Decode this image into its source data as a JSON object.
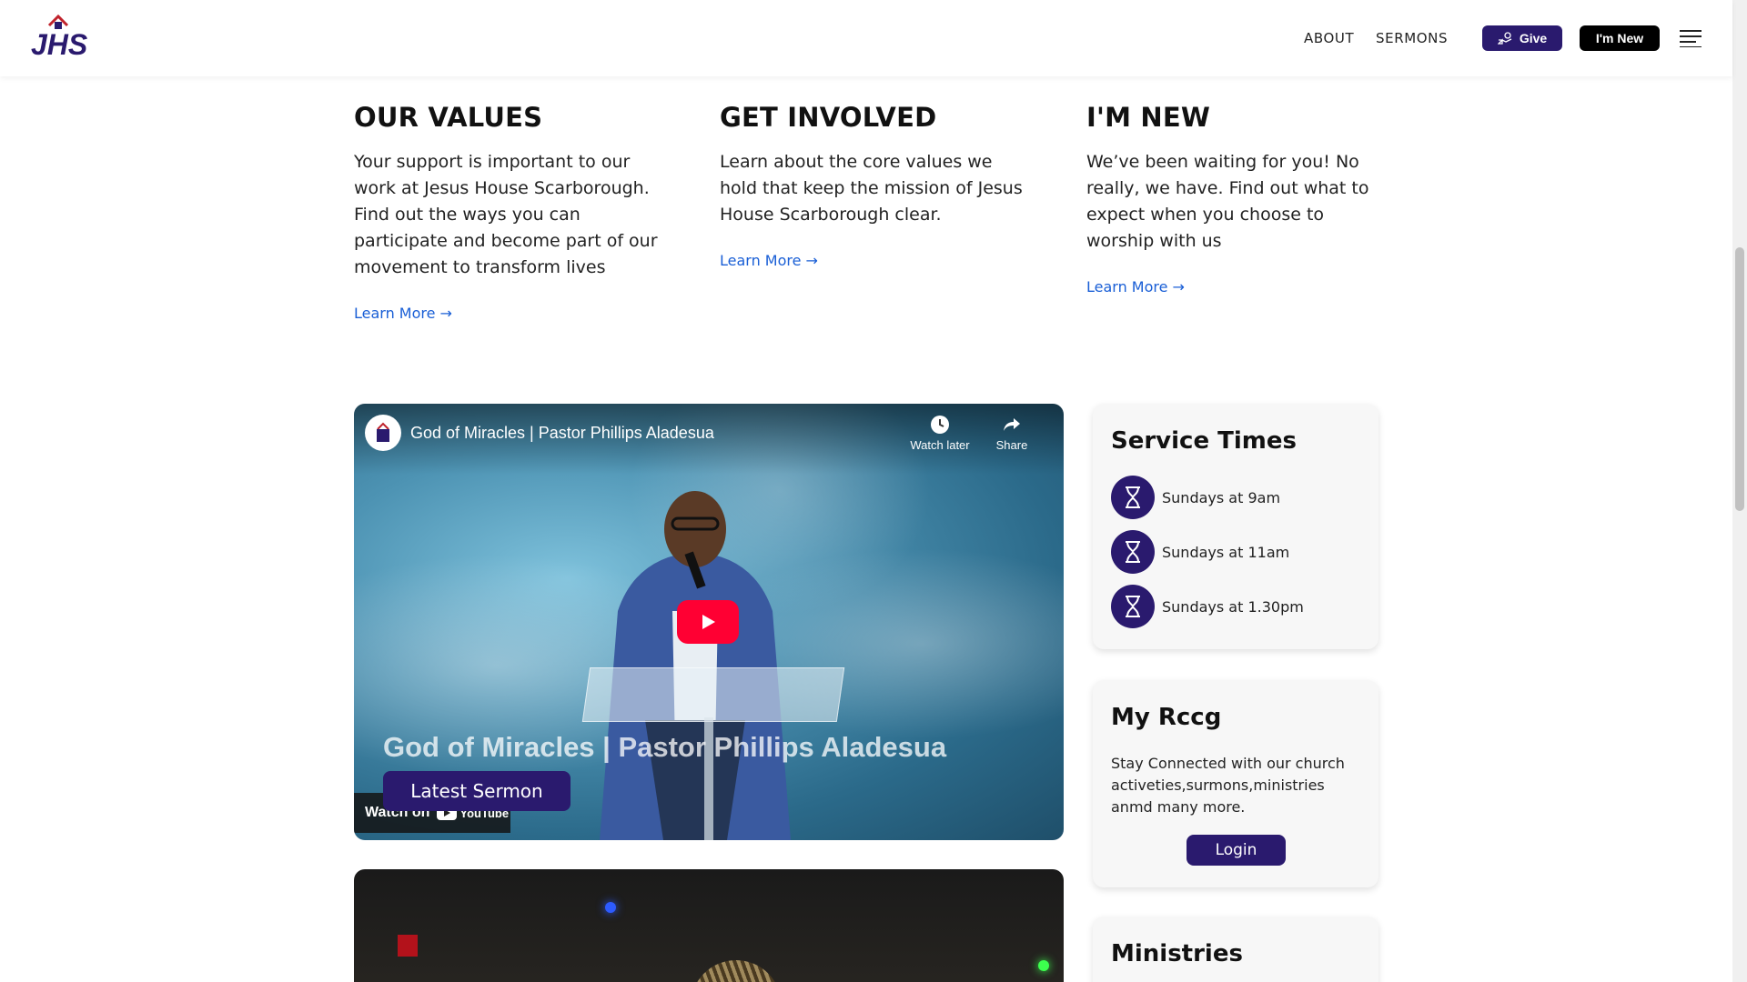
{
  "header": {
    "logo_text": "JHS",
    "nav": [
      "ABOUT",
      "SERMONS"
    ],
    "give_label": "Give",
    "new_label": "I'm New"
  },
  "columns": [
    {
      "title": "OUR VALUES",
      "body": "Your support is important to our work at Jesus House Scarborough. Find out the ways you can participate and become part of our movement to transform lives",
      "link": "Learn More →"
    },
    {
      "title": "GET INVOLVED",
      "body": "Learn about the core values we hold that keep the mission of Jesus House Scarborough clear.",
      "link": "Learn More →"
    },
    {
      "title": "I'M NEW",
      "body": "We’ve been waiting for you! No really, we have. Find out what to expect when you choose to worship with us",
      "link": "Learn More →"
    }
  ],
  "video": {
    "title": "God of Miracles | Pastor Phillips Aladesua",
    "overlay_title": "God of Miracles | Pastor Phillips Aladesua",
    "watch_later": "Watch later",
    "share": "Share",
    "watch_on": "Watch on",
    "youtube": "YouTube",
    "latest_sermon": "Latest Sermon"
  },
  "service_times": {
    "title": "Service Times",
    "items": [
      "Sundays at 9am",
      "Sundays at 11am",
      "Sundays at 1.30pm"
    ]
  },
  "my_rccg": {
    "title": "My Rccg",
    "text": "Stay Connected with our church activeties,surmons,ministries anmd many more.",
    "login_label": "Login"
  },
  "ministries": {
    "title": "Ministries"
  },
  "colors": {
    "brand": "#2a1a6e",
    "link": "#1a5fd6",
    "youtube_red": "#ff0033"
  }
}
